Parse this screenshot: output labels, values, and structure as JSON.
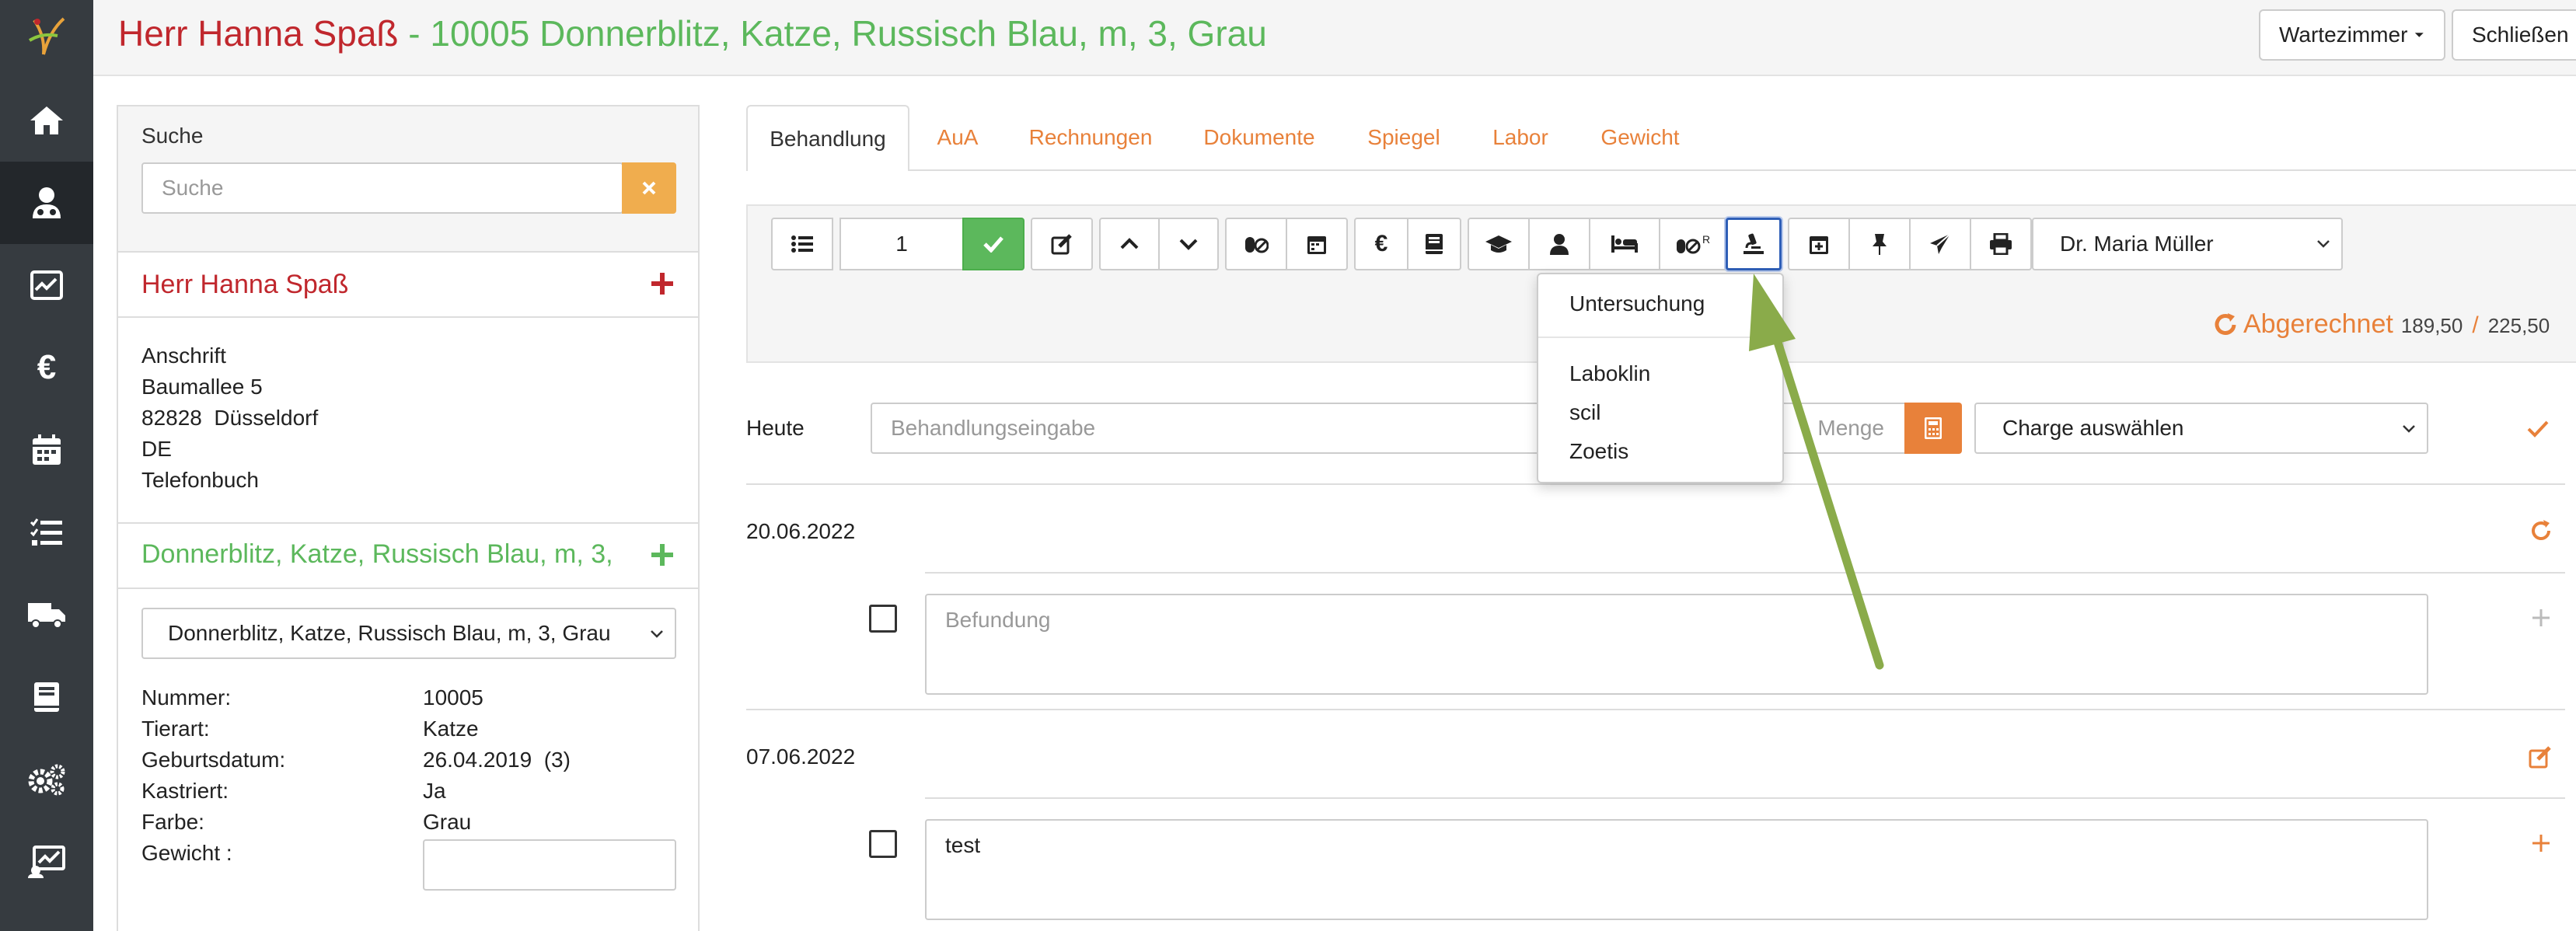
{
  "header": {
    "owner_name": "Herr Hanna Spaß",
    "animal_info": " - 10005 Donnerblitz, Katze, Russisch Blau, m, 3, Grau",
    "waiting_room_label": "Wartezimmer",
    "close_label": "Schließen"
  },
  "sidebar": {
    "items": [
      {
        "icon": "home-icon"
      },
      {
        "icon": "patient-icon"
      },
      {
        "icon": "monitor-icon"
      },
      {
        "icon": "euro-icon"
      },
      {
        "icon": "calendar-icon"
      },
      {
        "icon": "task-list-icon"
      },
      {
        "icon": "truck-icon"
      },
      {
        "icon": "book-icon"
      },
      {
        "icon": "settings-icon"
      },
      {
        "icon": "stats-icon"
      }
    ]
  },
  "left": {
    "search_label": "Suche",
    "search_placeholder": "Suche",
    "owner_name": "Herr Hanna Spaß",
    "address": {
      "title": "Anschrift",
      "street": "Baumallee 5",
      "city": "82828  Düsseldorf",
      "country": "DE",
      "phonebook": "Telefonbuch"
    },
    "animal_header": "Donnerblitz, Katze, Russisch Blau, m, 3, Grau",
    "animal_select": "Donnerblitz, Katze, Russisch Blau, m, 3, Grau",
    "details": [
      {
        "key": "Nummer:",
        "value": "10005"
      },
      {
        "key": "Tierart:",
        "value": "Katze"
      },
      {
        "key": "Geburtsdatum:",
        "value": "26.04.2019  (3)"
      },
      {
        "key": "Kastriert:",
        "value": "Ja"
      },
      {
        "key": "Farbe:",
        "value": "Grau"
      },
      {
        "key": "Gewicht :",
        "value": ""
      }
    ]
  },
  "tabs": [
    "Behandlung",
    "AuA",
    "Rechnungen",
    "Dokumente",
    "Spiegel",
    "Labor",
    "Gewicht"
  ],
  "toolbar": {
    "quantity": "1",
    "vet_select": "Dr. Maria Müller",
    "billed_label": "Abgerechnet",
    "billed_amount": "189,50",
    "separator": "/",
    "total_amount": "225,50"
  },
  "dropdown": {
    "items": [
      "Untersuchung",
      "Laboklin",
      "scil",
      "Zoetis"
    ]
  },
  "entry": {
    "today_label": "Heute",
    "treatment_placeholder": "Behandlungseingabe",
    "quantity_placeholder": "Menge",
    "charge_select": "Charge auswählen"
  },
  "entries": [
    {
      "date": "20.06.2022",
      "placeholder": "Befundung",
      "text": ""
    },
    {
      "date": "07.06.2022",
      "placeholder": "",
      "text": "test"
    }
  ],
  "colors": {
    "owner_red": "#c0272d",
    "animal_green": "#5cb85c",
    "accent_orange": "#e8813a",
    "sidebar_dark": "#363b40",
    "annotation_arrow": "#8aab4a"
  }
}
